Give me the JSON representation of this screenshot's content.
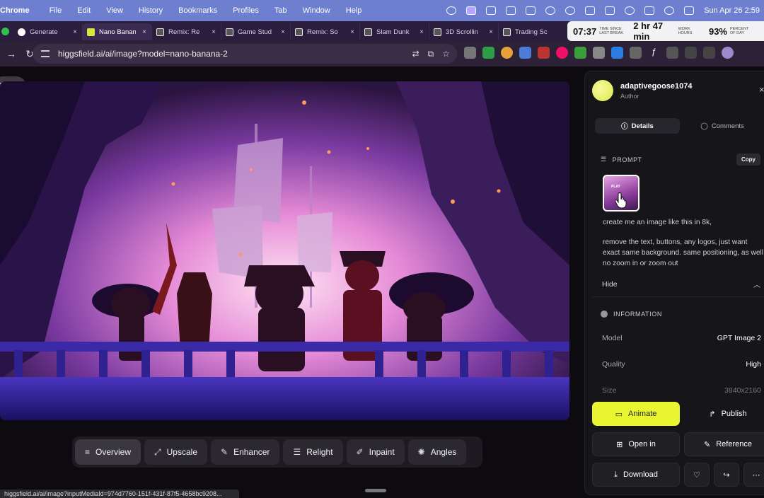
{
  "menubar": {
    "app": "Chrome",
    "items": [
      "File",
      "Edit",
      "View",
      "History",
      "Bookmarks",
      "Profiles",
      "Tab",
      "Window",
      "Help"
    ],
    "clock": "Sun Apr 26  2:59"
  },
  "tabs": [
    {
      "label": "Generate",
      "fav_color": "#ffffff",
      "active": false
    },
    {
      "label": "Nano Banana",
      "fav_color": "#d7e83a",
      "active": true
    },
    {
      "label": "Remix: Re",
      "fav_color": "#ffffff",
      "active": false
    },
    {
      "label": "Game Stud",
      "fav_color": "#ffffff",
      "active": false
    },
    {
      "label": "Remix: So",
      "fav_color": "#ffffff",
      "active": false
    },
    {
      "label": "Slam Dunk",
      "fav_color": "#ffffff",
      "active": false
    },
    {
      "label": "3D Scrollin",
      "fav_color": "#ffffff",
      "active": false
    },
    {
      "label": "Trading Sc",
      "fav_color": "#ffffff",
      "active": false
    }
  ],
  "tab_close": "×",
  "stats": [
    {
      "big": "07:37",
      "small": "TIME SINCE LAST BREAK"
    },
    {
      "big": "2 hr 47 min",
      "small": "WORK HOURS"
    },
    {
      "big": "93%",
      "small": "PERCENT OF DAY"
    }
  ],
  "address": {
    "url": "higgsfield.ai/ai/image?model=nano-banana-2"
  },
  "back_label": "Back",
  "toolbar": [
    {
      "label": "Overview",
      "icon": "≡",
      "name": "overview"
    },
    {
      "label": "Upscale",
      "icon": "⤢",
      "name": "upscale"
    },
    {
      "label": "Enhancer",
      "icon": "✎",
      "name": "enhancer"
    },
    {
      "label": "Relight",
      "icon": "☰",
      "name": "relight"
    },
    {
      "label": "Inpaint",
      "icon": "✐",
      "name": "inpaint"
    },
    {
      "label": "Angles",
      "icon": "✺",
      "name": "angles"
    }
  ],
  "status_url": "higgsfield.ai/ai/image?inputMediaId=974d7760-151f-431f-87f5-4658bc9208...",
  "panel": {
    "username": "adaptivegoose1074",
    "role": "Author",
    "close": "×",
    "tab_details": "Details",
    "tab_comments": "Comments",
    "prompt_title": "PROMPT",
    "copy": "Copy",
    "thumb_text": "PLAY",
    "prompt_lines": [
      "create me an image like this in 8k,",
      "remove the text, buttons, any logos, just want exact same background. same positioning, as well, no zoom in or zoom out"
    ],
    "hide": "Hide",
    "info_title": "INFORMATION",
    "info": [
      {
        "k": "Model",
        "v": "GPT Image 2"
      },
      {
        "k": "Quality",
        "v": "High"
      },
      {
        "k": "Size",
        "v": "3840x2160"
      }
    ],
    "animate": "Animate",
    "publish": "Publish",
    "open_in": "Open in",
    "reference": "Reference",
    "download": "Download"
  },
  "colors": {
    "accent": "#e8f530",
    "menubar": "#6f7fd0"
  }
}
